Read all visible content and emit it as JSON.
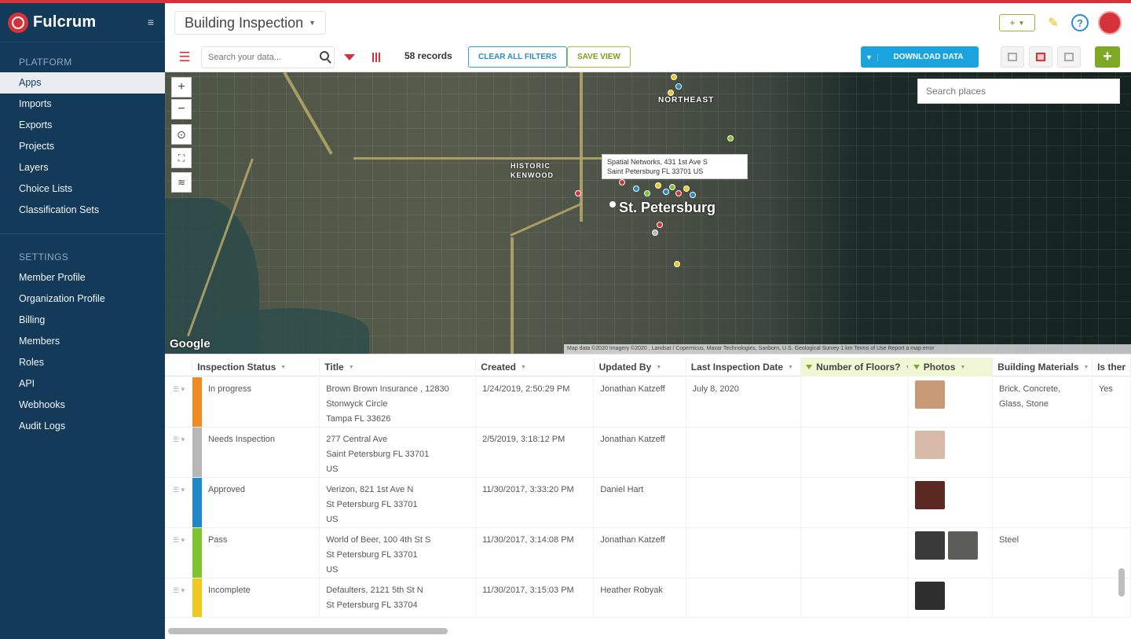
{
  "brand": {
    "name": "Fulcrum"
  },
  "sidebar": {
    "platform_heading": "PLATFORM",
    "platform_items": [
      "Apps",
      "Imports",
      "Exports",
      "Projects",
      "Layers",
      "Choice Lists",
      "Classification Sets"
    ],
    "settings_heading": "SETTINGS",
    "settings_items": [
      "Member Profile",
      "Organization Profile",
      "Billing",
      "Members",
      "Roles",
      "API",
      "Webhooks",
      "Audit Logs"
    ],
    "active": "Apps"
  },
  "header": {
    "app_title": "Building Inspection"
  },
  "toolbar": {
    "search_placeholder": "Search your data...",
    "records": "58 records",
    "clear_filters": "CLEAR ALL FILTERS",
    "save_view": "SAVE VIEW",
    "download": "DOWNLOAD DATA"
  },
  "map": {
    "search_placeholder": "Search places",
    "popup_line1": "Spatial Networks, 431 1st Ave S",
    "popup_line2": "Saint Petersburg FL 33701 US",
    "label_city": "St. Petersburg",
    "label_northeast": "NORTHEAST",
    "label_historic": "HISTORIC",
    "label_kenwood": "KENWOOD",
    "google": "Google",
    "attribution": "Map data ©2020 Imagery ©2020 , Landsat / Copernicus, Maxar Technologies, Sanborn, U.S. Geological Survey  1 km  Terms of Use  Report a map error"
  },
  "table": {
    "columns": [
      {
        "label": "Inspection Status",
        "filtered": false
      },
      {
        "label": "Title",
        "filtered": false
      },
      {
        "label": "Created",
        "filtered": false
      },
      {
        "label": "Updated By",
        "filtered": false
      },
      {
        "label": "Last Inspection Date",
        "filtered": false
      },
      {
        "label": "Number of Floors?",
        "filtered": true
      },
      {
        "label": "Photos",
        "filtered": true
      },
      {
        "label": "Building Materials",
        "filtered": false
      },
      {
        "label": "Is ther",
        "filtered": false
      }
    ],
    "rows": [
      {
        "status": "In progress",
        "status_color": "#f28a22",
        "title_lines": [
          "Brown Brown Insurance , 12830",
          "Stonwyck Circle",
          "Tampa FL 33626"
        ],
        "created": "1/24/2019, 2:50:29 PM",
        "updated_by": "Jonathan Katzeff",
        "last_inspection": "July 8, 2020",
        "floors": "",
        "photos": 1,
        "materials": "Brick, Concrete, Glass, Stone",
        "is_there": "Yes"
      },
      {
        "status": "Needs Inspection",
        "status_color": "#b7b7b7",
        "title_lines": [
          "277 Central Ave",
          "Saint Petersburg FL 33701",
          "US"
        ],
        "created": "2/5/2019, 3:18:12 PM",
        "updated_by": "Jonathan Katzeff",
        "last_inspection": "",
        "floors": "",
        "photos": 1,
        "materials": "",
        "is_there": ""
      },
      {
        "status": "Approved",
        "status_color": "#1e88c8",
        "title_lines": [
          "Verizon, 821 1st Ave N",
          "St Petersburg FL 33701",
          "US"
        ],
        "created": "11/30/2017, 3:33:20 PM",
        "updated_by": "Daniel Hart",
        "last_inspection": "",
        "floors": "",
        "photos": 1,
        "materials": "",
        "is_there": ""
      },
      {
        "status": "Pass",
        "status_color": "#7cc52e",
        "title_lines": [
          "World of Beer, 100 4th St S",
          "St Petersburg FL 33701",
          "US"
        ],
        "created": "11/30/2017, 3:14:08 PM",
        "updated_by": "Jonathan Katzeff",
        "last_inspection": "",
        "floors": "",
        "photos": 2,
        "materials": "Steel",
        "is_there": ""
      },
      {
        "status": "Incomplete",
        "status_color": "#f2c81e",
        "title_lines": [
          "Defaulters, 2121 5th St N",
          "St Petersburg FL 33704"
        ],
        "created": "11/30/2017, 3:15:03 PM",
        "updated_by": "Heather Robyak",
        "last_inspection": "",
        "floors": "",
        "photos": 1,
        "materials": "",
        "is_there": ""
      }
    ]
  },
  "colors": {
    "sidebar_bg": "#143a5a",
    "accent_red": "#d6323a",
    "download_blue": "#1aa3dc",
    "add_green": "#7fa827"
  }
}
